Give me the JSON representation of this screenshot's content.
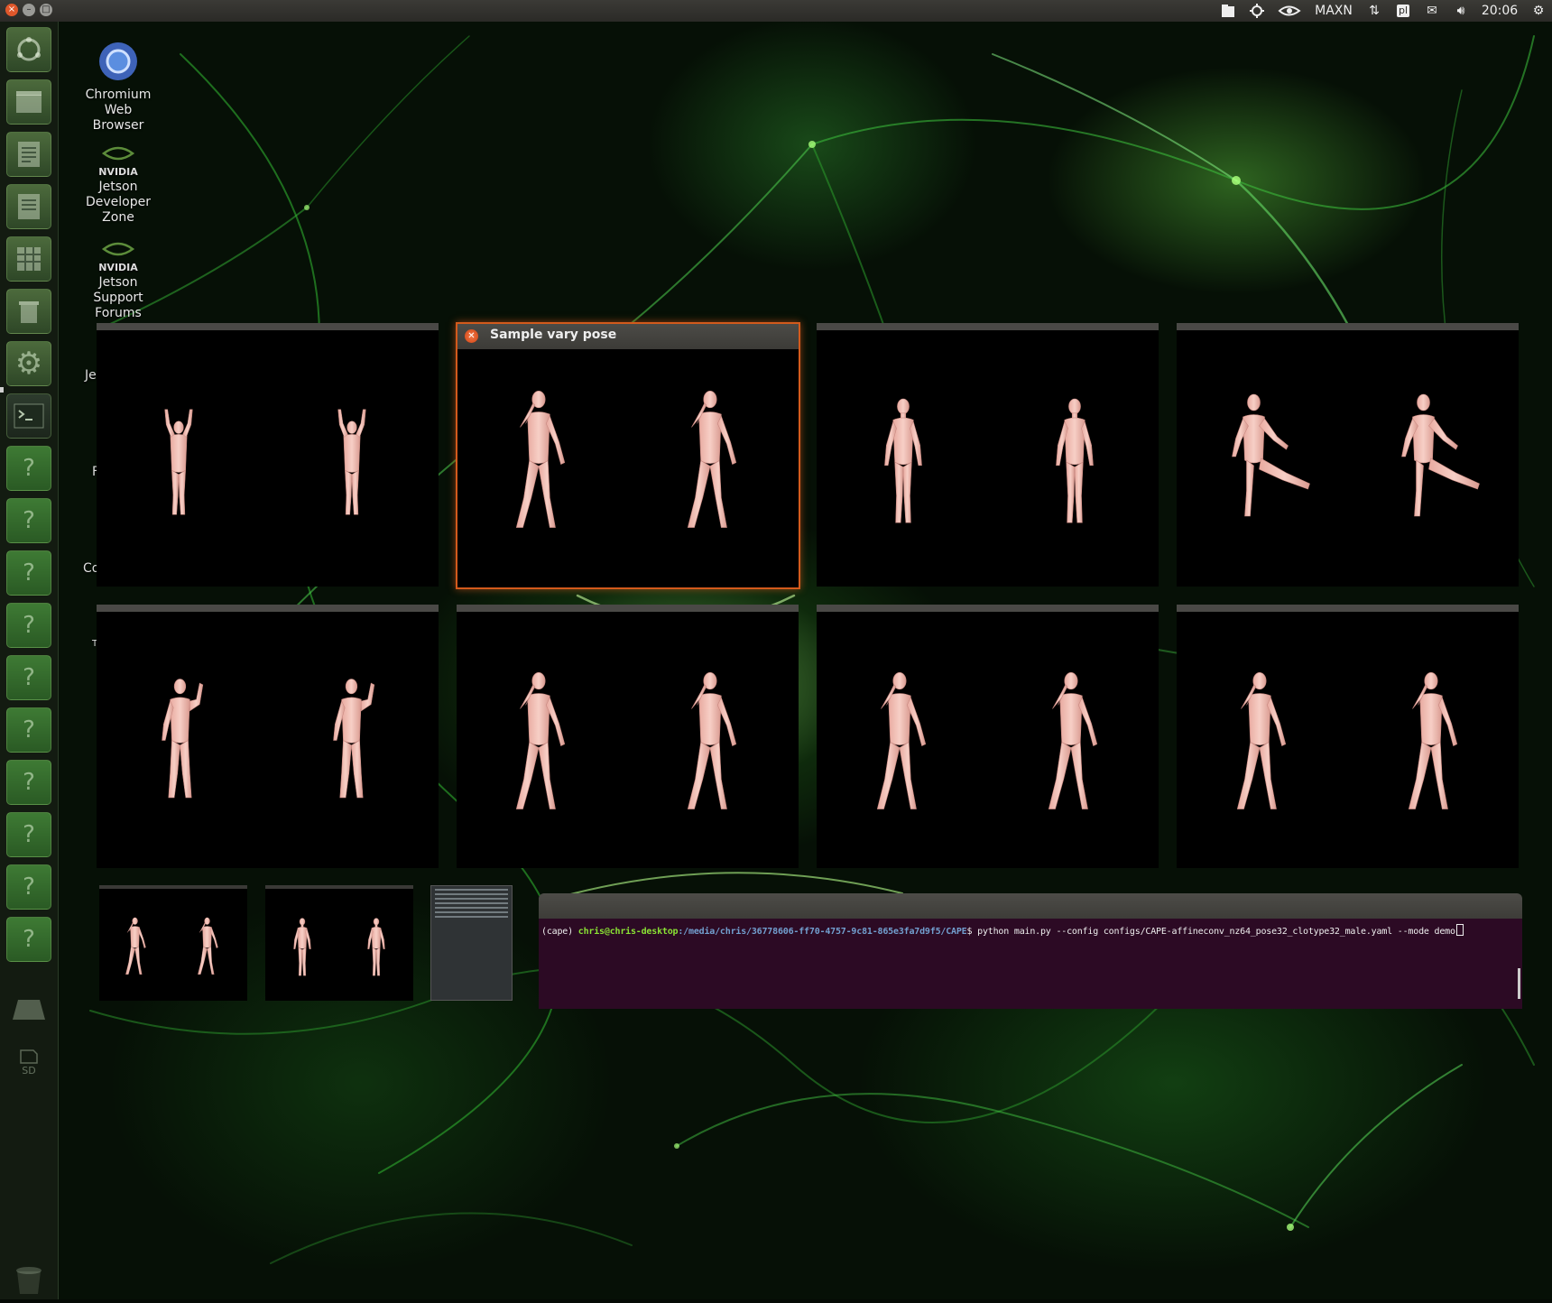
{
  "topbar": {
    "power_mode": "MAXN",
    "clock": "20:06",
    "icons": [
      "files-icon",
      "nvidia-settings-icon",
      "nvidia-logo-icon",
      "network-arrows-icon",
      "keyboard-layout-icon",
      "mail-icon",
      "volume-icon",
      "gear-icon"
    ],
    "keyboard_layout": "pl"
  },
  "desktop_icons": [
    {
      "label_lines": [
        "Chromium",
        "Web",
        "Browser"
      ],
      "icon": "chromium-icon"
    },
    {
      "label_lines": [
        "Jetson",
        "Developer",
        "Zone"
      ],
      "icon": "nvidia-icon",
      "logo_text": "NVIDIA"
    },
    {
      "label_lines": [
        "Jetson",
        "Support",
        "Forums"
      ],
      "icon": "nvidia-icon",
      "logo_text": "NVIDIA"
    }
  ],
  "partial_labels": [
    "Je",
    "F",
    "Co",
    "T"
  ],
  "launcher": {
    "items": [
      "ubuntu-dash-icon",
      "files-icon",
      "text-editor-icon",
      "document-viewer-icon",
      "spreadsheet-icon",
      "trash-app-icon",
      "system-settings-icon",
      "terminal-icon",
      "unknown-app-icon",
      "unknown-app-icon",
      "unknown-app-icon",
      "unknown-app-icon",
      "unknown-app-icon",
      "unknown-app-icon",
      "unknown-app-icon",
      "unknown-app-icon",
      "unknown-app-icon",
      "unknown-app-icon",
      "drive-icon",
      "sd-card-icon"
    ],
    "sd_label": "SD"
  },
  "windows": {
    "active_title": "Sample vary pose",
    "count": 8
  },
  "terminal": {
    "env": "(cape)",
    "user_host": "chris@chris-desktop",
    "path": ":/media/chris/36778606-ff70-4757-9c81-865e3fa7d9f5/CAPE",
    "command": "$ python main.py --config configs/CAPE-affineconv_nz64_pose32_clotype32_male.yaml --mode demo"
  }
}
